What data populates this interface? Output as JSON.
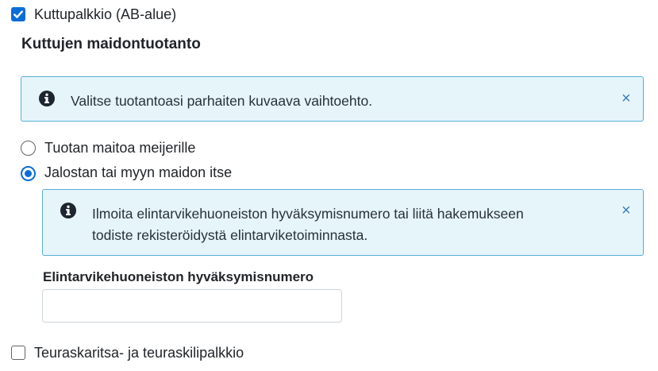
{
  "goat_premium": {
    "checked": true,
    "label": "Kuttupalkkio (AB-alue)"
  },
  "section": {
    "heading": "Kuttujen maidontuotanto"
  },
  "info_alert_1": {
    "icon": "info-icon",
    "text": "Valitse tuotantoasi parhaiten kuvaava vaihtoehto.",
    "close_symbol": "×"
  },
  "production_options": [
    {
      "label": "Tuotan maitoa meijerille",
      "selected": false
    },
    {
      "label": "Jalostan tai myyn maidon itse",
      "selected": true
    }
  ],
  "info_alert_2": {
    "icon": "info-icon",
    "line1": "Ilmoita elintarvikehuoneiston hyväksymisnumero tai liitä hakemukseen",
    "line2": "todiste rekisteröidystä elintarviketoiminnasta.",
    "close_symbol": "×"
  },
  "approval_field": {
    "label": "Elintarvikehuoneiston hyväksymisnumero",
    "value": "",
    "placeholder": ""
  },
  "slaughter_premium": {
    "checked": false,
    "label": "Teuraskaritsa- ja teuraskilipalkkio"
  },
  "colors": {
    "accent": "#0b6ed8",
    "alert_background": "#e6f5fa",
    "alert_border": "#58afd6",
    "close_icon": "#3d80b6"
  }
}
